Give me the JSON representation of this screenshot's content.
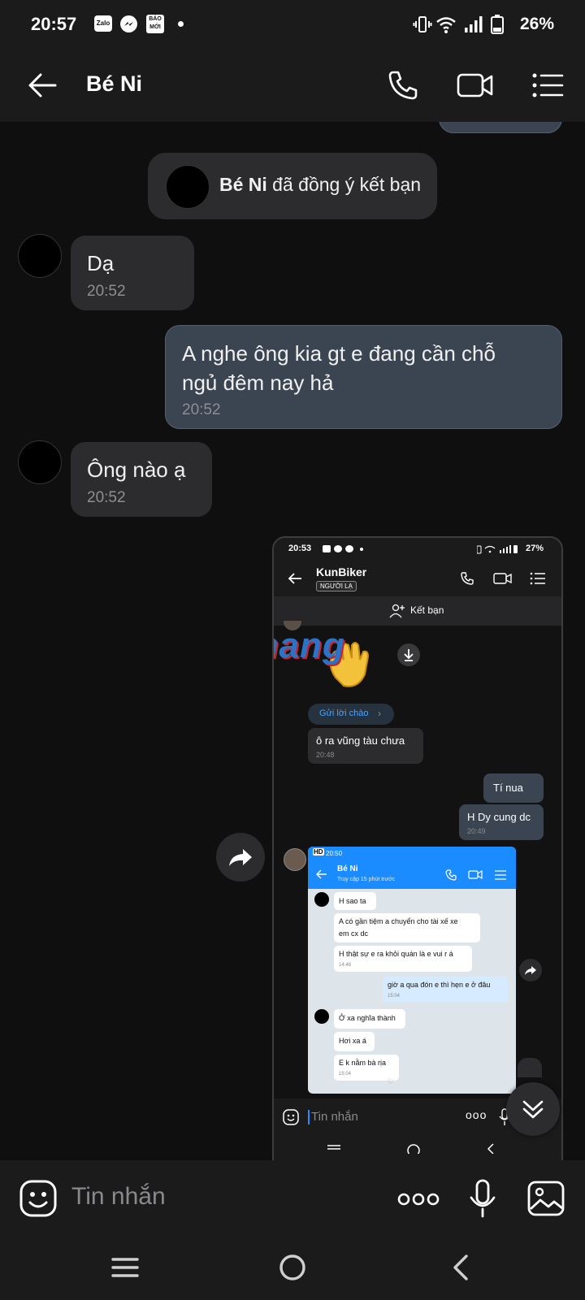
{
  "status_bar": {
    "time": "20:57",
    "battery": "26%",
    "app_badges": [
      "Zalo",
      "BÁO MỚI"
    ]
  },
  "header": {
    "title": "Bé Ni"
  },
  "messages": {
    "system_notice_name": "Bé Ni",
    "system_notice_text": " đã đồng ý kết bạn",
    "m1_text": "Dạ",
    "m1_time": "20:52",
    "m2_text_line1": "A nghe ông kia gt e đang cần chỗ",
    "m2_text_line2": "ngủ đêm nay hả",
    "m2_time": "20:52",
    "m3_text": "Ông nào ạ",
    "m3_time": "20:52"
  },
  "screenshot": {
    "time": "20:53",
    "battery": "27%",
    "contact": "KunBiker",
    "badge": "NGƯỜI LẠ",
    "add_friend": "Kết bạn",
    "greeting": "Gửi lời chào",
    "msg1": "ô ra vũng tàu chưa",
    "msg1_time": "20:48",
    "msg2": "Tí nua",
    "msg3": "H Dy cung dc",
    "msg3_time": "20:49",
    "input_placeholder": "Tin nhắn",
    "watermark": "Rphang",
    "nested": {
      "time": "20:50",
      "hd": "HD",
      "contact": "Bé Ni",
      "sub": "Truy cập 15 phút trước",
      "n1": "H sao ta",
      "n2a": "A có gần tiệm a chuyển cho tài xế xe",
      "n2b": "em cx dc",
      "n3": "H thật sự e ra khỏi quán là e vui r á",
      "n3_time": "14:48",
      "n4": "giờ a qua đón e thì hẹn e ở đâu",
      "n4_time": "15:04",
      "n5": "Ở xa nghĩa thành",
      "n6": "Hơi xa á",
      "n7": "E k nằm bà rịa",
      "n7_time": "15:04"
    }
  },
  "input": {
    "placeholder": "Tin nhắn"
  }
}
